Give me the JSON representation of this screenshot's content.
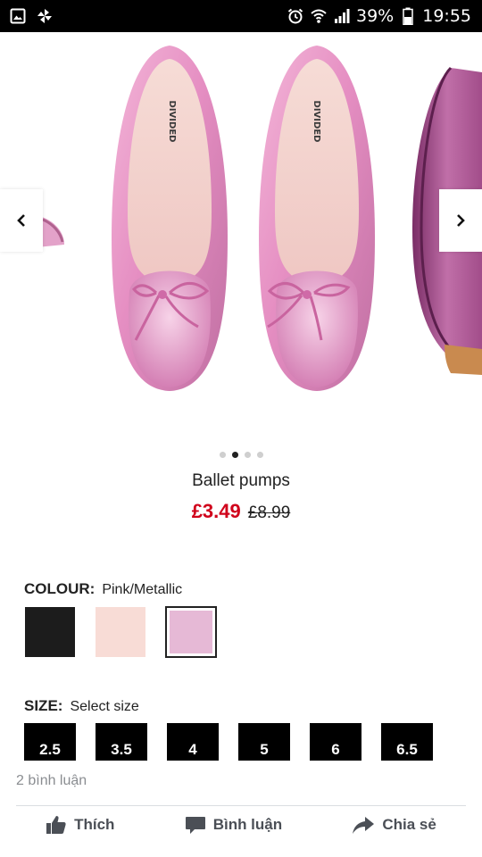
{
  "status_bar": {
    "battery": "39%",
    "time": "19:55",
    "icons": [
      "gallery-icon",
      "pinwheel-icon",
      "alarm-icon",
      "wifi-icon",
      "signal-icon",
      "battery-icon"
    ]
  },
  "carousel": {
    "prev_icon": "chevron-left-icon",
    "next_icon": "chevron-right-icon",
    "dot_count": 4,
    "active_dot": 1,
    "insole_brand": "DIVIDED"
  },
  "product": {
    "name": "Ballet pumps",
    "price_sale": "£3.49",
    "price_original": "£8.99"
  },
  "colour": {
    "label": "COLOUR:",
    "selected_value": "Pink/Metallic",
    "swatches": [
      {
        "name": "black",
        "hex": "#1c1c1c"
      },
      {
        "name": "light-pink",
        "hex": "#f8dcd6"
      },
      {
        "name": "pink-metallic",
        "hex": "#e6b9d6",
        "selected": true
      }
    ]
  },
  "size": {
    "label": "SIZE:",
    "placeholder": "Select size",
    "options": [
      "2.5",
      "3.5",
      "4",
      "5",
      "6",
      "6.5"
    ]
  },
  "facebook": {
    "comments": "2 bình luận",
    "like_label": "Thích",
    "comment_label": "Bình luận",
    "share_label": "Chia sẻ"
  }
}
